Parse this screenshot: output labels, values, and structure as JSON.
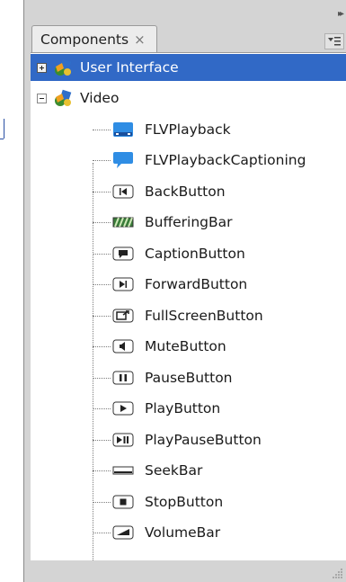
{
  "panel": {
    "tab_label": "Components",
    "tab_close_glyph": "×",
    "collapse_glyph": "▸▸",
    "colors": {
      "selection": "#3169c6",
      "panel_bg": "#d4d4d4",
      "tree_bg": "#ffffff",
      "icon_blue": "#2f8de4"
    }
  },
  "tree": {
    "groups": [
      {
        "label": "User Interface",
        "expanded": false,
        "selected": true,
        "icon": "component-folder-icon"
      },
      {
        "label": "Video",
        "expanded": true,
        "selected": false,
        "icon": "component-folder-icon"
      }
    ],
    "video_items": [
      {
        "label": "FLVPlayback",
        "icon": "flvplayback-icon"
      },
      {
        "label": "FLVPlaybackCaptioning",
        "icon": "speech-bubble-icon"
      },
      {
        "label": "BackButton",
        "icon": "back-button-icon"
      },
      {
        "label": "BufferingBar",
        "icon": "buffering-bar-icon"
      },
      {
        "label": "CaptionButton",
        "icon": "caption-button-icon"
      },
      {
        "label": "ForwardButton",
        "icon": "forward-button-icon"
      },
      {
        "label": "FullScreenButton",
        "icon": "fullscreen-button-icon"
      },
      {
        "label": "MuteButton",
        "icon": "mute-button-icon"
      },
      {
        "label": "PauseButton",
        "icon": "pause-button-icon"
      },
      {
        "label": "PlayButton",
        "icon": "play-button-icon"
      },
      {
        "label": "PlayPauseButton",
        "icon": "play-pause-button-icon"
      },
      {
        "label": "SeekBar",
        "icon": "seek-bar-icon"
      },
      {
        "label": "StopButton",
        "icon": "stop-button-icon"
      },
      {
        "label": "VolumeBar",
        "icon": "volume-bar-icon"
      }
    ]
  }
}
